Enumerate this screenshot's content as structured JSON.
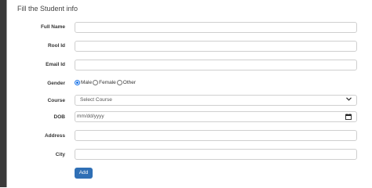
{
  "form": {
    "title": "Fill the Student info",
    "fields": {
      "full_name": {
        "label": "Full Name",
        "value": ""
      },
      "roll_id": {
        "label": "Rool Id",
        "value": ""
      },
      "email_id": {
        "label": "Email Id",
        "value": ""
      },
      "gender": {
        "label": "Gender",
        "options": [
          "Male",
          "Female",
          "Other"
        ],
        "selected": "Male"
      },
      "course": {
        "label": "Course",
        "selected": "Select Course"
      },
      "dob": {
        "label": "DOB",
        "placeholder": "mm/dd/yyyy"
      },
      "address": {
        "label": "Address",
        "value": ""
      },
      "city": {
        "label": "City",
        "value": ""
      }
    },
    "submit_label": "Add"
  },
  "icons": {
    "course_dropdown": "chevron-down-icon",
    "dob_picker": "calendar-icon"
  },
  "colors": {
    "button_bg": "#2f6fb5",
    "radio_selected": "#1a73e8",
    "left_bar": "#3a3a3a"
  }
}
